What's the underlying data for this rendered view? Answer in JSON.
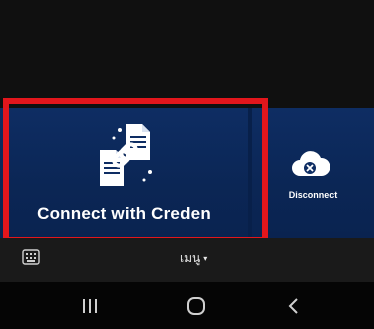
{
  "tiles": {
    "connect": {
      "label": "Connect with Creden",
      "icon": "document-link-icon"
    },
    "disconnect": {
      "label": "Disconnect",
      "icon": "cloud-disconnect-icon"
    }
  },
  "toolbar": {
    "keyboard_icon": "keyboard-icon",
    "menu_label": "เมนู",
    "menu_caret": "▾"
  },
  "navbar": {
    "recents_icon": "recents-icon",
    "home_icon": "home-icon",
    "back_icon": "back-icon"
  },
  "colors": {
    "tile_background": "#0e2d63",
    "highlight_border": "#e3161c",
    "toolbar_background": "#1a1a1a",
    "navbar_background": "#050505"
  }
}
